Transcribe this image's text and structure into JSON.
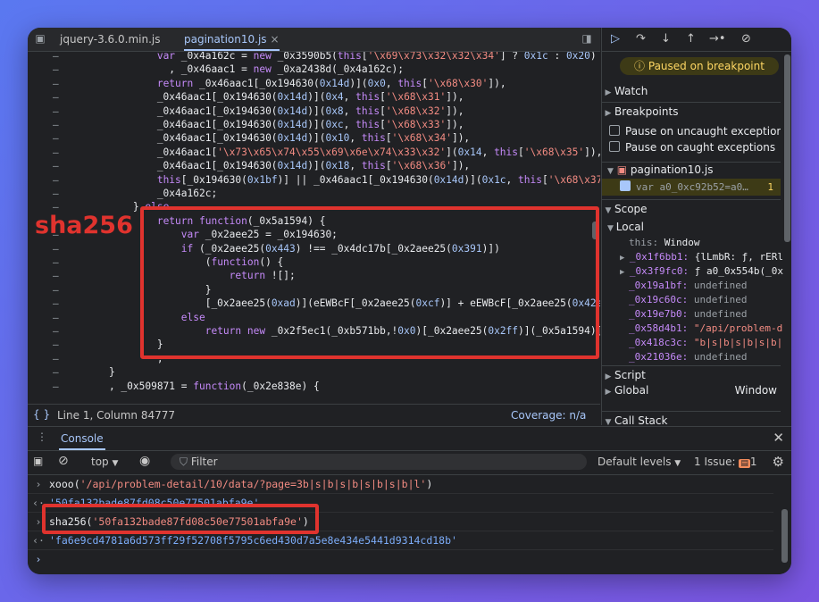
{
  "tabs": [
    {
      "label": "jquery-3.6.0.min.js"
    },
    {
      "label": "pagination10.js",
      "close": "×"
    }
  ],
  "code_lines": [
    "            var _0x4a162c = new _0x3590b5(this['\\x69\\x73\\x32\\x32\\x34'] ? 0x1c : 0x20)",
    "              , _0x46aac1 = new _0xa2438d(_0x4a162c);",
    "            return _0x46aac1[_0x194630(0x14d)](0x0, this['\\x68\\x30']),",
    "            _0x46aac1[_0x194630(0x14d)](0x4, this['\\x68\\x31']),",
    "            _0x46aac1[_0x194630(0x14d)](0x8, this['\\x68\\x32']),",
    "            _0x46aac1[_0x194630(0x14d)](0xc, this['\\x68\\x33']),",
    "            _0x46aac1[_0x194630(0x14d)](0x10, this['\\x68\\x34']),",
    "            _0x46aac1['\\x73\\x65\\x74\\x55\\x69\\x6e\\x74\\x33\\x32'](0x14, this['\\x68\\x35']),",
    "            _0x46aac1[_0x194630(0x14d)](0x18, this['\\x68\\x36']),",
    "            this[_0x194630(0x1bf)] || _0x46aac1[_0x194630(0x14d)](0x1c, this['\\x68\\x37",
    "            _0x4a162c;",
    "        } else",
    "            return function(_0x5a1594) {",
    "                var _0x2aee25 = _0x194630;",
    "                if (_0x2aee25(0x443) !== _0x4dc17b[_0x2aee25(0x391)])",
    "                    (function() {",
    "                        return ![];",
    "                    }",
    "                    [_0x2aee25(0xad)](eEWBcF[_0x2aee25(0xcf)] + eEWBcF[_0x2aee25(0x42e",
    "                else",
    "                    return new _0x2f5ec1(_0xb571bb,!0x0)[_0x2aee25(0x2ff)](_0x5a1594)[",
    "            }",
    "            ;",
    "    }",
    "    , _0x509871 = function(_0x2e838e) {"
  ],
  "annotation": "sha256",
  "status": {
    "position": "Line 1, Column 84777",
    "coverage": "Coverage: n/a"
  },
  "debugger": {
    "paused": "Paused on breakpoint",
    "watch": "Watch",
    "breakpoints": "Breakpoints",
    "pause_uncaught": "Pause on uncaught exceptions",
    "pause_caught": "Pause on caught exceptions",
    "bp_file": "pagination10.js",
    "bp_code": "var a0_0xc92b52=a0…",
    "bp_line": "1",
    "scope": "Scope",
    "local": "Local",
    "this_key": "this:",
    "this_val": "Window",
    "vars": [
      {
        "k": "_0x1f6bb1:",
        "v": "{lLmbR: ƒ, rERl"
      },
      {
        "k": "_0x3f9fc0:",
        "v": "ƒ a0_0x554b(_0x"
      },
      {
        "k": "_0x19a1bf:",
        "v": "undefined"
      },
      {
        "k": "_0x19c60c:",
        "v": "undefined"
      },
      {
        "k": "_0x19e7b0:",
        "v": "undefined"
      },
      {
        "k": "_0x58d4b1:",
        "v": "\"/api/problem-d"
      },
      {
        "k": "_0x418c3c:",
        "v": "\"b|s|b|s|b|s|b|"
      },
      {
        "k": "_0x21036e:",
        "v": "undefined"
      }
    ],
    "script": "Script",
    "global": "Global",
    "global_val": "Window",
    "callstack": "Call Stack"
  },
  "console": {
    "tab": "Console",
    "context": "top",
    "filter_placeholder": "Filter",
    "levels": "Default levels",
    "issues_label": "1 Issue:",
    "issues_count": "1",
    "lines": [
      {
        "kind": "in",
        "text": "xooo('/api/problem-detail/10/data/?page=3b|s|b|s|b|s|b|s|b|l')"
      },
      {
        "kind": "out",
        "text": "'50fa132bade87fd08c50e77501abfa9e'"
      },
      {
        "kind": "in",
        "text": "sha256('50fa132bade87fd08c50e77501abfa9e')"
      },
      {
        "kind": "out",
        "text": "'fa6e9cd4781a6d573ff29f52708f5795c6ed430d7a5e8e434e5441d9314cd18b'"
      }
    ]
  },
  "colors": {
    "accent": "#a8c7fa",
    "highlight": "#e0332e",
    "paused": "#fdd663"
  }
}
